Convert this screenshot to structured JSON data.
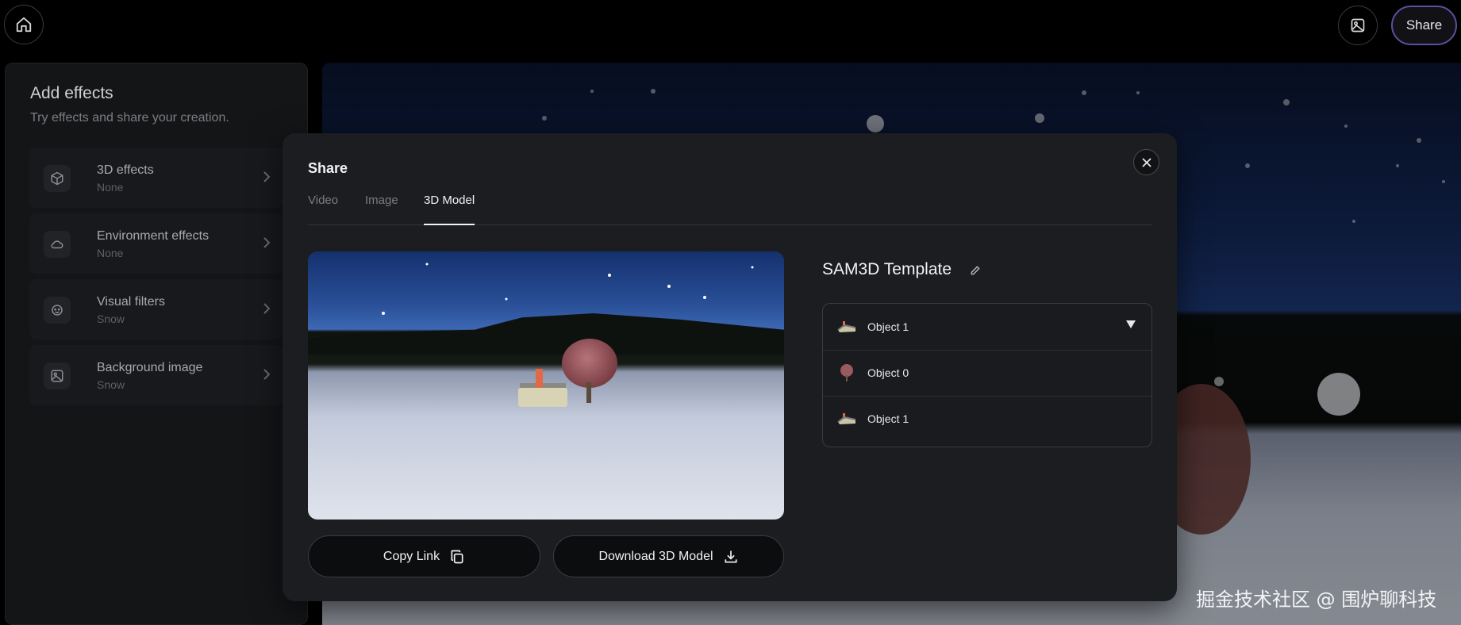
{
  "topbar": {
    "home_icon": "home-icon",
    "gallery_icon": "image-icon",
    "share_label": "Share"
  },
  "effects_panel": {
    "title": "Add effects",
    "subtitle": "Try effects and share your creation.",
    "items": [
      {
        "label": "3D effects",
        "value": "None",
        "icon": "cube-icon"
      },
      {
        "label": "Environment effects",
        "value": "None",
        "icon": "cloud-icon"
      },
      {
        "label": "Visual filters",
        "value": "Snow",
        "icon": "sparkle-face-icon"
      },
      {
        "label": "Background image",
        "value": "Snow",
        "icon": "image-icon"
      }
    ]
  },
  "share_modal": {
    "title": "Share",
    "tabs": [
      {
        "label": "Video",
        "active": false
      },
      {
        "label": "Image",
        "active": false
      },
      {
        "label": "3D Model",
        "active": true
      }
    ],
    "model_name": "SAM3D Template",
    "dropdown": {
      "selected": "Object 1",
      "options": [
        "Object 0",
        "Object 1"
      ]
    },
    "copy_link_label": "Copy Link",
    "download_label": "Download 3D Model"
  },
  "watermark": "掘金技术社区 @ 围炉聊科技",
  "colors": {
    "accent_border": "#5a4fa0",
    "modal_bg": "#1c1d20",
    "page_bg": "#000000"
  }
}
